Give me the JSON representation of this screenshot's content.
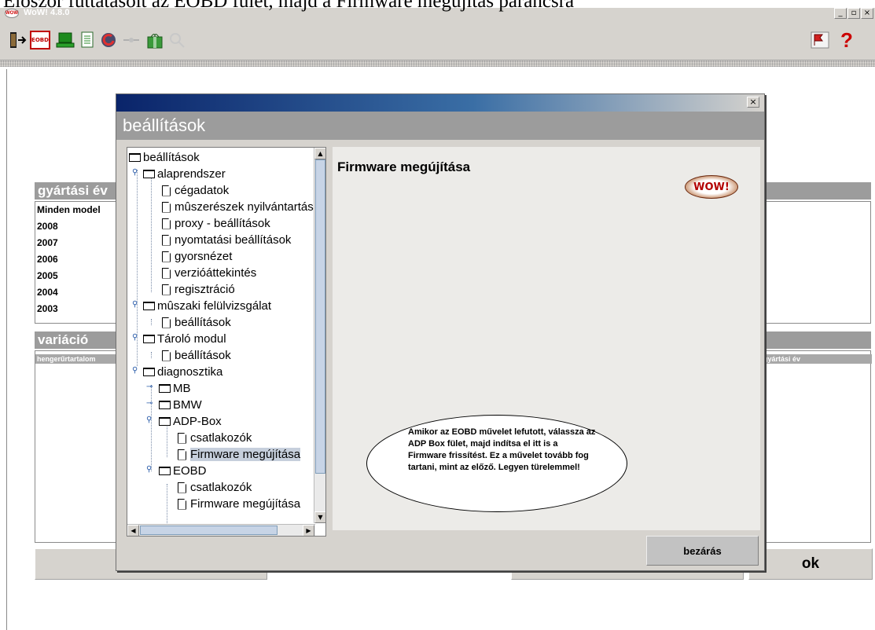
{
  "caption": "Először futtatásolt az EOBD fület, majd a Firmware megújítás parancsra",
  "window": {
    "title": "WoW! 4.8.0",
    "app_icon_text": "WOW",
    "minimize": "_",
    "maximize": "▫",
    "close": "×"
  },
  "toolbar": {
    "icons": [
      "exit-door-icon",
      "eobd-icon",
      "laptop-icon",
      "document-icon",
      "refresh-car-icon",
      "connect-icon",
      "gift-icon",
      "search-disabled-icon",
      "flag-icon",
      "help-icon"
    ],
    "eobd_label": "EOBD",
    "help_label": "?"
  },
  "background": {
    "production_year_header": "gyártási év",
    "years": [
      "Minden model",
      "2008",
      "2007",
      "2006",
      "2005",
      "2004",
      "2003"
    ],
    "variation_header": "variáció",
    "column_left": "hengerűrtartalom",
    "column_right": "gyártási év",
    "ok_label": "ok"
  },
  "dialog": {
    "close_x": "×",
    "header": "beállítások",
    "tree": [
      {
        "label": "beállítások",
        "type": "folder"
      },
      {
        "label": "alaprendszer",
        "type": "folder"
      },
      {
        "label": "cégadatok",
        "type": "doc"
      },
      {
        "label": "mûszerészek nyilvántartása",
        "type": "doc"
      },
      {
        "label": "proxy - beállítások",
        "type": "doc"
      },
      {
        "label": "nyomtatási beállítások",
        "type": "doc"
      },
      {
        "label": "gyorsnézet",
        "type": "doc"
      },
      {
        "label": "verzióáttekintés",
        "type": "doc"
      },
      {
        "label": "regisztráció",
        "type": "doc"
      },
      {
        "label": "mûszaki felülvizsgálat",
        "type": "folder"
      },
      {
        "label": "beállítások",
        "type": "doc"
      },
      {
        "label": "Tároló modul",
        "type": "folder"
      },
      {
        "label": "beállítások",
        "type": "doc"
      },
      {
        "label": "diagnosztika",
        "type": "folder"
      },
      {
        "label": "MB",
        "type": "folder"
      },
      {
        "label": "BMW",
        "type": "folder"
      },
      {
        "label": "ADP-Box",
        "type": "folder"
      },
      {
        "label": "csatlakozók",
        "type": "doc"
      },
      {
        "label": "Firmware megújítása",
        "type": "doc",
        "selected": true
      },
      {
        "label": "EOBD",
        "type": "folder"
      },
      {
        "label": "csatlakozók",
        "type": "doc"
      },
      {
        "label": "Firmware megújítása",
        "type": "doc"
      }
    ],
    "content_title": "Firmware megújítása",
    "logo_text": "WOW!",
    "info_text": "Amikor az EOBD művelet lefutott, válassza az ADP Box fület, majd indítsa el itt is a Firmware frissítést. Ez a művelet tovább fog tartani, mint az előző. Legyen türelemmel!",
    "close_button": "bezárás"
  }
}
